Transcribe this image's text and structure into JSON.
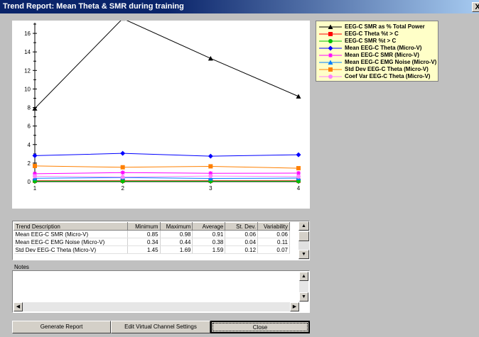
{
  "window": {
    "title": "Trend Report: Mean Theta & SMR during training",
    "close_label": "X"
  },
  "colors": {
    "title_bar": "#0a246a",
    "legend_bg": "#ffffc8"
  },
  "chart_data": {
    "type": "line",
    "x": [
      1,
      2,
      3,
      4
    ],
    "xlabels": [
      "1",
      "2",
      "3",
      "4"
    ],
    "ylim": [
      0,
      17
    ],
    "yticks": [
      0,
      2,
      4,
      6,
      8,
      10,
      12,
      14,
      16
    ],
    "series": [
      {
        "name": "EEG-C SMR as % Total Power",
        "color": "#000000",
        "marker": "triangle",
        "values": [
          7.9,
          17.6,
          13.3,
          9.2
        ]
      },
      {
        "name": "EEG-C Theta %t > C",
        "color": "#ff0000",
        "marker": "square",
        "values": [
          0.1,
          0.1,
          0.1,
          0.1
        ]
      },
      {
        "name": "EEG-C SMR %t > C",
        "color": "#00c000",
        "marker": "circle",
        "values": [
          0.05,
          0.05,
          0.05,
          0.05
        ]
      },
      {
        "name": "Mean EEG-C Theta (Micro-V)",
        "color": "#0000ff",
        "marker": "diamond",
        "values": [
          2.8,
          3.05,
          2.75,
          2.9
        ]
      },
      {
        "name": "Mean EEG-C SMR (Micro-V)",
        "color": "#ff00ff",
        "marker": "star",
        "values": [
          0.85,
          0.98,
          0.9,
          0.92
        ]
      },
      {
        "name": "Mean EEG-C EMG Noise (Micro-V)",
        "color": "#0080ff",
        "marker": "triangle",
        "values": [
          0.36,
          0.44,
          0.34,
          0.38
        ]
      },
      {
        "name": "Std Dev EEG-C Theta (Micro-V)",
        "color": "#ff8000",
        "marker": "square",
        "values": [
          1.69,
          1.55,
          1.65,
          1.45
        ]
      },
      {
        "name": "Coef Var EEG-C Theta (Micro-V)",
        "color": "#ff80ff",
        "marker": "circle",
        "values": [
          0.58,
          0.5,
          0.6,
          0.55
        ]
      }
    ]
  },
  "table": {
    "headers": [
      "Trend Description",
      "Minimum",
      "Maximum",
      "Average",
      "St. Dev.",
      "Variability"
    ],
    "rows": [
      [
        "Mean EEG-C SMR (Micro-V)",
        "0.85",
        "0.98",
        "0.91",
        "0.06",
        "0.06"
      ],
      [
        "Mean EEG-C EMG Noise (Micro-V)",
        "0.34",
        "0.44",
        "0.38",
        "0.04",
        "0.11"
      ],
      [
        "Std Dev EEG-C Theta (Micro-V)",
        "1.45",
        "1.69",
        "1.59",
        "0.12",
        "0.07"
      ]
    ]
  },
  "notes": {
    "label": "Notes",
    "value": ""
  },
  "buttons": {
    "generate": "Generate Report",
    "edit": "Edit Virtual Channel Settings",
    "close": "Close"
  }
}
